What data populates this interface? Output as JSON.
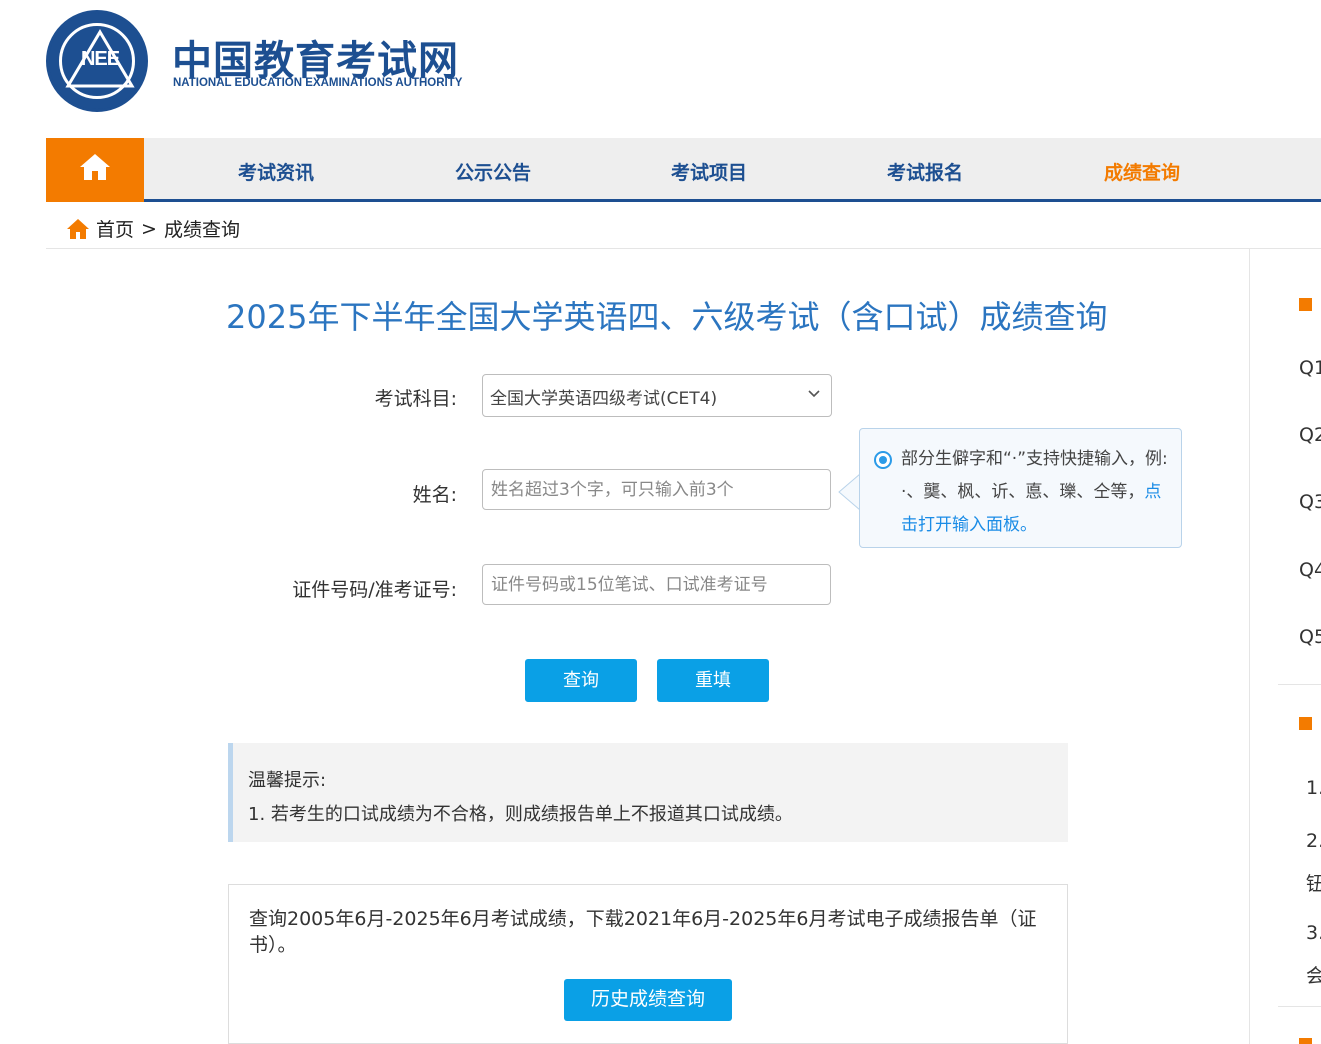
{
  "header": {
    "logo_text": "NEE",
    "site_title": "中国教育考试网",
    "site_subtitle": "NATIONAL EDUCATION EXAMINATIONS AUTHORITY"
  },
  "nav": {
    "items": [
      {
        "label": "考试资讯"
      },
      {
        "label": "公示公告"
      },
      {
        "label": "考试项目"
      },
      {
        "label": "考试报名"
      },
      {
        "label": "成绩查询"
      }
    ],
    "active_color": "#f37b00",
    "primary_color": "#1d4f91"
  },
  "breadcrumb": {
    "home": "首页",
    "separator": ">",
    "current": "成绩查询"
  },
  "main": {
    "title": "2025年下半年全国大学英语四、六级考试（含口试）成绩查询",
    "form": {
      "subject_label": "考试科目:",
      "subject_value": "全国大学英语四级考试(CET4)",
      "name_label": "姓名:",
      "name_placeholder": "姓名超过3个字，可只输入前3个",
      "id_label": "证件号码/准考证号:",
      "id_placeholder": "证件号码或15位笔试、口试准考证号"
    },
    "tip": {
      "text": "部分生僻字和“·”支持快捷输入，例: ·、龑、枫、䜣、悳、瓅、仝等，",
      "link": "点击打开输入面板。"
    },
    "buttons": {
      "query": "查询",
      "reset": "重填"
    },
    "notice": {
      "heading": "温馨提示:",
      "line1": "1. 若考生的口试成绩为不合格，则成绩报告单上不报道其口试成绩。"
    },
    "history": {
      "text": "查询2005年6月-2025年6月考试成绩，下载2021年6月-2025年6月考试电子成绩报告单（证书）。",
      "button": "历史成绩查询"
    }
  },
  "sidebar": {
    "questions": [
      "Q1",
      "Q2",
      "Q3",
      "Q4",
      "Q5"
    ],
    "numbers": [
      "1.",
      "2.",
      "钮",
      "3.",
      "会"
    ]
  }
}
